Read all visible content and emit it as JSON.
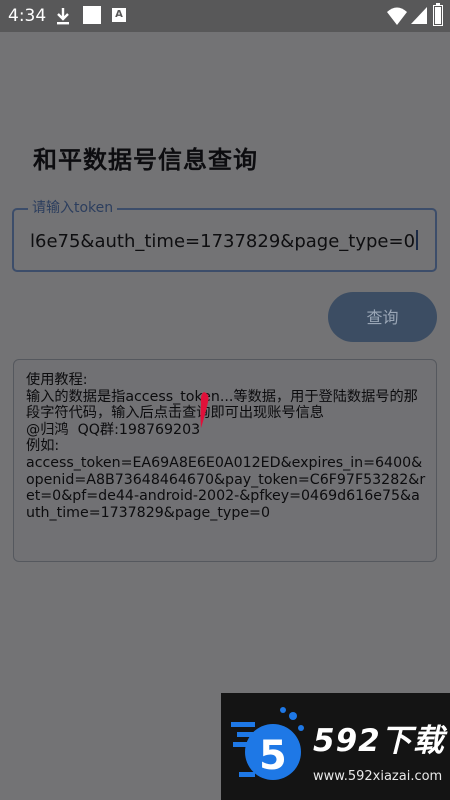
{
  "status_bar": {
    "time": "4:34",
    "left_icons": [
      "download-icon",
      "notification-square-icon",
      "app-a-icon"
    ],
    "a_glyph": "A",
    "right_icons": [
      "wifi-icon",
      "signal-icon",
      "battery-icon"
    ]
  },
  "page": {
    "title": "和平数据号信息查询"
  },
  "token_input": {
    "label": "请输入token",
    "value": "l6e75&auth_time=1737829&page_type=0"
  },
  "query_button": {
    "label": "查询"
  },
  "tutorial": {
    "text": "使用教程:\n输入的数据是指access_token...等数据，用于登陆数据号的那段字符代码，输入后点击查询即可出现账号信息\n@归鸿  QQ群:198769203\n例如:\naccess_token=EA69A8E6E0A012ED&expires_in=6400&openid=A8B73648464670&pay_token=C6F97F53282&ret=0&pf=de44-android-2002-&pfkey=0469d616e75&auth_time=1737829&page_type=0"
  },
  "watermark": {
    "name": "592下载",
    "url": "www.592xiazai.com",
    "logo_glyph": "5"
  },
  "colors": {
    "background": "#737375",
    "status_bar": "#585859",
    "accent": "#3c4d63",
    "cursor_mark": "#e0103a"
  }
}
